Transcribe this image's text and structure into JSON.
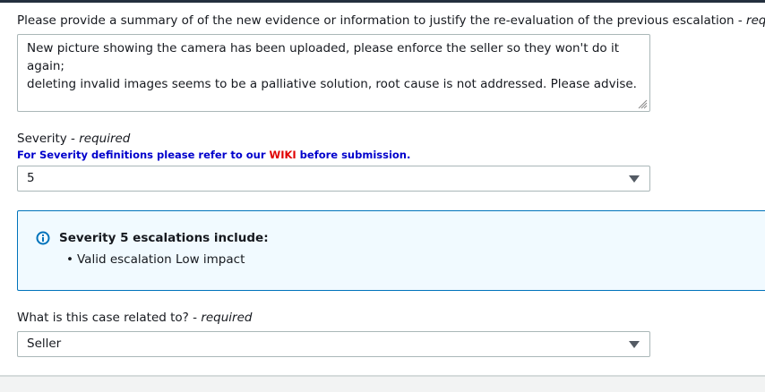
{
  "summary": {
    "label": "Please provide a summary of of the new evidence or information to justify the re-evaluation of the previous escalation - ",
    "required": "required",
    "value": "New picture showing the camera has been uploaded, please enforce the seller so they won't do it again;\ndeleting invalid images seems to be a palliative solution, root cause is not addressed. Please advise."
  },
  "severity": {
    "label": "Severity - ",
    "required": "required",
    "hint_before": "For Severity definitions please refer to our ",
    "hint_link": "WIKI",
    "hint_after": " before submission.",
    "selected": "5"
  },
  "info": {
    "title": "Severity 5 escalations include:",
    "items": [
      "Valid escalation Low impact"
    ],
    "icon": "info-icon",
    "accent_color": "#0073bb"
  },
  "case": {
    "label": "What is this case related to? - ",
    "required": "required",
    "selected": "Seller"
  }
}
